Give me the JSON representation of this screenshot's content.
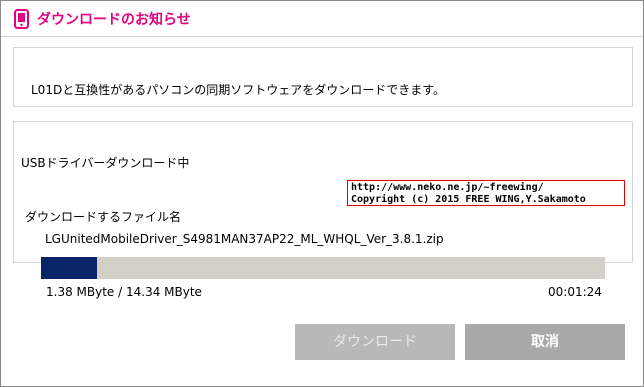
{
  "window": {
    "title": "ダウンロードのお知らせ",
    "accent_color": "#e4007f",
    "icon": "phone-icon"
  },
  "info": {
    "message": "L01Dと互換性があるパソコンの同期ソフトウェアをダウンロードできます。"
  },
  "download": {
    "status": "USBドライバーダウンロード中",
    "file_label": "ダウンロードするファイル名",
    "file_name": "LGUnitedMobileDriver_S4981MAN37AP22_ML_WHQL_Ver_3.8.1.zip",
    "progress_text": "1.38 MByte / 14.34 MByte",
    "progress_fraction": 0.1,
    "elapsed": "00:01:24",
    "progress_color": "#0a246a"
  },
  "watermark": {
    "line1": "http://www.neko.ne.jp/~freewing/",
    "line2": "Copyright (c) 2015 FREE WING,Y.Sakamoto"
  },
  "buttons": {
    "download_label": "ダウンロード",
    "cancel_label": "取消"
  }
}
